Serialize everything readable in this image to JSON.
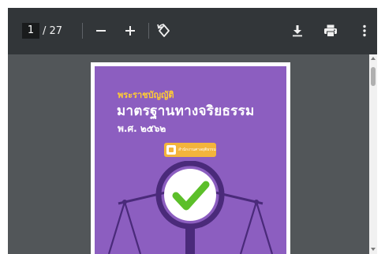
{
  "toolbar": {
    "current_page": "1",
    "page_total": "/ 27",
    "zoom_out_icon": "minus-icon",
    "zoom_in_icon": "plus-icon",
    "rotate_icon": "rotate-counterclockwise-icon",
    "download_icon": "download-icon",
    "print_icon": "print-icon",
    "more_icon": "more-vert-icon"
  },
  "document": {
    "cover": {
      "title_small": "พระราชบัญญัติ",
      "title_main": "มาตรฐานทางจริยธรรม",
      "title_year": "พ.ศ. ๒๕๖๒",
      "logo_text": "สำนักงานศาลยุติธรรม"
    }
  },
  "colors": {
    "toolbar_bg": "#323639",
    "viewer_bg": "#525659",
    "cover_purple": "#8c5ec0",
    "title_gold": "#ffcc33",
    "check_green": "#5cbf2a",
    "scale_dark": "#4a2a7a"
  }
}
